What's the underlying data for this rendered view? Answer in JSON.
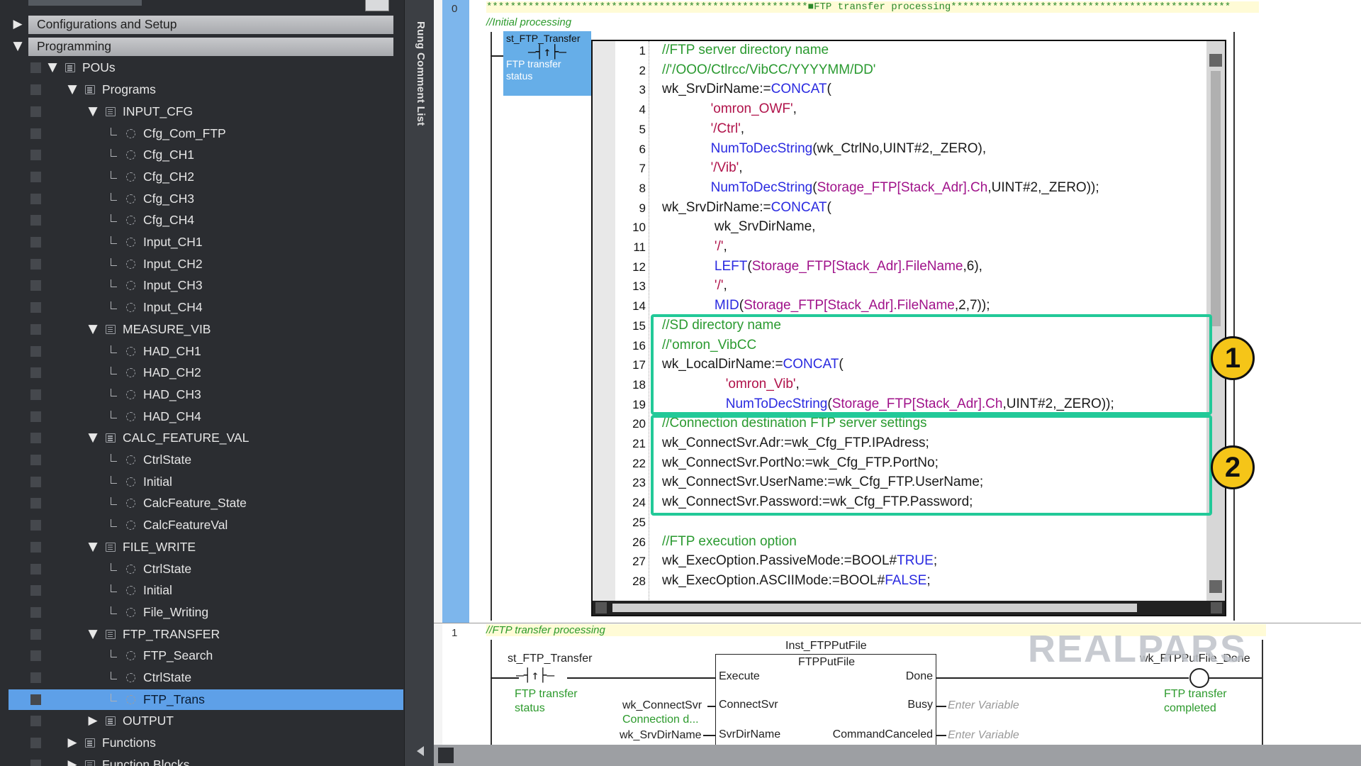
{
  "tree": {
    "items": [
      {
        "label": "Configurations and Setup",
        "toggle": "▶",
        "level": 0,
        "icon": "",
        "header": true
      },
      {
        "label": "Programming",
        "toggle": "▼",
        "level": 0,
        "icon": "",
        "header": true
      },
      {
        "label": "POUs",
        "toggle": "▼",
        "level": 1,
        "icon": "folder-icon"
      },
      {
        "label": "Programs",
        "toggle": "▼",
        "level": 2,
        "icon": "program-list-icon"
      },
      {
        "label": "INPUT_CFG",
        "toggle": "▼",
        "level": 3,
        "icon": "program-icon"
      },
      {
        "label": "Cfg_Com_FTP",
        "toggle": "",
        "level": 4,
        "icon": "section-icon"
      },
      {
        "label": "Cfg_CH1",
        "toggle": "",
        "level": 4,
        "icon": "section-icon"
      },
      {
        "label": "Cfg_CH2",
        "toggle": "",
        "level": 4,
        "icon": "section-icon"
      },
      {
        "label": "Cfg_CH3",
        "toggle": "",
        "level": 4,
        "icon": "section-icon"
      },
      {
        "label": "Cfg_CH4",
        "toggle": "",
        "level": 4,
        "icon": "section-icon"
      },
      {
        "label": "Input_CH1",
        "toggle": "",
        "level": 4,
        "icon": "section-icon"
      },
      {
        "label": "Input_CH2",
        "toggle": "",
        "level": 4,
        "icon": "section-icon"
      },
      {
        "label": "Input_CH3",
        "toggle": "",
        "level": 4,
        "icon": "section-icon"
      },
      {
        "label": "Input_CH4",
        "toggle": "",
        "level": 4,
        "icon": "section-icon"
      },
      {
        "label": "MEASURE_VIB",
        "toggle": "▼",
        "level": 3,
        "icon": "program-icon"
      },
      {
        "label": "HAD_CH1",
        "toggle": "",
        "level": 4,
        "icon": "section-icon"
      },
      {
        "label": "HAD_CH2",
        "toggle": "",
        "level": 4,
        "icon": "section-icon"
      },
      {
        "label": "HAD_CH3",
        "toggle": "",
        "level": 4,
        "icon": "section-icon"
      },
      {
        "label": "HAD_CH4",
        "toggle": "",
        "level": 4,
        "icon": "section-icon"
      },
      {
        "label": "CALC_FEATURE_VAL",
        "toggle": "▼",
        "level": 3,
        "icon": "program-icon"
      },
      {
        "label": "CtrlState",
        "toggle": "",
        "level": 4,
        "icon": "section-icon"
      },
      {
        "label": "Initial",
        "toggle": "",
        "level": 4,
        "icon": "section-icon"
      },
      {
        "label": "CalcFeature_State",
        "toggle": "",
        "level": 4,
        "icon": "section-icon"
      },
      {
        "label": "CalcFeatureVal",
        "toggle": "",
        "level": 4,
        "icon": "section-icon"
      },
      {
        "label": "FILE_WRITE",
        "toggle": "▼",
        "level": 3,
        "icon": "program-icon"
      },
      {
        "label": "CtrlState",
        "toggle": "",
        "level": 4,
        "icon": "section-icon"
      },
      {
        "label": "Initial",
        "toggle": "",
        "level": 4,
        "icon": "section-icon"
      },
      {
        "label": "File_Writing",
        "toggle": "",
        "level": 4,
        "icon": "section-icon"
      },
      {
        "label": "FTP_TRANSFER",
        "toggle": "▼",
        "level": 3,
        "icon": "program-icon"
      },
      {
        "label": "FTP_Search",
        "toggle": "",
        "level": 4,
        "icon": "section-icon"
      },
      {
        "label": "CtrlState",
        "toggle": "",
        "level": 4,
        "icon": "section-icon"
      },
      {
        "label": "FTP_Trans",
        "toggle": "",
        "level": 4,
        "icon": "section-icon",
        "selected": true
      },
      {
        "label": "OUTPUT",
        "toggle": "▶",
        "level": 3,
        "icon": "program-icon"
      },
      {
        "label": "Functions",
        "toggle": "▶",
        "level": 2,
        "icon": "program-list-icon"
      },
      {
        "label": "Function Blocks",
        "toggle": "▶",
        "level": 2,
        "icon": "program-list-icon"
      }
    ]
  },
  "sidebar_panel": {
    "label": "Rung Comment List"
  },
  "rung0": {
    "number": "0",
    "header": "******************************************************■FTP transfer processing***********************************************",
    "comment": "//Initial processing",
    "contact_name": "st_FTP_Transfer",
    "contact_symbol": "—┤↑├—",
    "contact_comment": "FTP transfer status"
  },
  "st_code": {
    "lines": [
      {
        "n": "1",
        "parts": [
          [
            "cm",
            "//FTP server directory name"
          ]
        ]
      },
      {
        "n": "2",
        "parts": [
          [
            "cm",
            "//'/OOO/Ctlrcc/VibCC/YYYYMM/DD'"
          ]
        ]
      },
      {
        "n": "3",
        "parts": [
          [
            "",
            "wk_SrvDirName:="
          ],
          [
            "kw",
            "CONCAT"
          ],
          [
            "",
            "("
          ]
        ]
      },
      {
        "n": "4",
        "parts": [
          [
            "",
            "             "
          ],
          [
            "st",
            "'omron_OWF'"
          ],
          [
            "",
            ","
          ]
        ]
      },
      {
        "n": "5",
        "parts": [
          [
            "",
            "             "
          ],
          [
            "st",
            "'/Ctrl'"
          ],
          [
            "",
            ","
          ]
        ]
      },
      {
        "n": "6",
        "parts": [
          [
            "",
            "             "
          ],
          [
            "kw",
            "NumToDecString"
          ],
          [
            "",
            "(wk_CtrlNo,UINT#2,_ZERO),"
          ]
        ]
      },
      {
        "n": "7",
        "parts": [
          [
            "",
            "             "
          ],
          [
            "st",
            "'/Vib'"
          ],
          [
            "",
            ","
          ]
        ]
      },
      {
        "n": "8",
        "parts": [
          [
            "",
            "             "
          ],
          [
            "kw",
            "NumToDecString"
          ],
          [
            "",
            "("
          ],
          [
            "pv",
            "Storage_FTP[Stack_Adr].Ch"
          ],
          [
            "",
            ",UINT#2,_ZERO));"
          ]
        ]
      },
      {
        "n": "9",
        "parts": [
          [
            "",
            "wk_SrvDirName:="
          ],
          [
            "kw",
            "CONCAT"
          ],
          [
            "",
            "("
          ]
        ]
      },
      {
        "n": "10",
        "parts": [
          [
            "",
            "              wk_SrvDirName,"
          ]
        ]
      },
      {
        "n": "11",
        "parts": [
          [
            "",
            "              "
          ],
          [
            "st",
            "'/'"
          ],
          [
            "",
            ","
          ]
        ]
      },
      {
        "n": "12",
        "parts": [
          [
            "",
            "              "
          ],
          [
            "kw",
            "LEFT"
          ],
          [
            "",
            "("
          ],
          [
            "pv",
            "Storage_FTP[Stack_Adr].FileName"
          ],
          [
            "",
            ",6),"
          ]
        ]
      },
      {
        "n": "13",
        "parts": [
          [
            "",
            "              "
          ],
          [
            "st",
            "'/'"
          ],
          [
            "",
            ","
          ]
        ]
      },
      {
        "n": "14",
        "parts": [
          [
            "",
            "              "
          ],
          [
            "kw",
            "MID"
          ],
          [
            "",
            "("
          ],
          [
            "pv",
            "Storage_FTP[Stack_Adr].FileName"
          ],
          [
            "",
            ",2,7));"
          ]
        ]
      },
      {
        "n": "15",
        "parts": [
          [
            "cm",
            "//SD directory name"
          ]
        ]
      },
      {
        "n": "16",
        "parts": [
          [
            "cm",
            "//'omron_VibCC"
          ]
        ]
      },
      {
        "n": "17",
        "parts": [
          [
            "",
            "wk_LocalDirName:="
          ],
          [
            "kw",
            "CONCAT"
          ],
          [
            "",
            "("
          ]
        ]
      },
      {
        "n": "18",
        "parts": [
          [
            "",
            "                 "
          ],
          [
            "st",
            "'omron_Vib'"
          ],
          [
            "",
            ","
          ]
        ]
      },
      {
        "n": "19",
        "parts": [
          [
            "",
            "                 "
          ],
          [
            "kw",
            "NumToDecString"
          ],
          [
            "",
            "("
          ],
          [
            "pv",
            "Storage_FTP[Stack_Adr].Ch"
          ],
          [
            "",
            ",UINT#2,_ZERO));"
          ]
        ]
      },
      {
        "n": "20",
        "parts": [
          [
            "cm",
            "//Connection destination FTP server settings"
          ]
        ]
      },
      {
        "n": "21",
        "parts": [
          [
            "",
            "wk_ConnectSvr.Adr:=wk_Cfg_FTP.IPAdress;"
          ]
        ]
      },
      {
        "n": "22",
        "parts": [
          [
            "",
            "wk_ConnectSvr.PortNo:=wk_Cfg_FTP.PortNo;"
          ]
        ]
      },
      {
        "n": "23",
        "parts": [
          [
            "",
            "wk_ConnectSvr.UserName:=wk_Cfg_FTP.UserName;"
          ]
        ]
      },
      {
        "n": "24",
        "parts": [
          [
            "",
            "wk_ConnectSvr.Password:=wk_Cfg_FTP.Password;"
          ]
        ]
      },
      {
        "n": "25",
        "parts": [
          [
            "",
            ""
          ]
        ]
      },
      {
        "n": "26",
        "parts": [
          [
            "cm",
            "//FTP execution option"
          ]
        ]
      },
      {
        "n": "27",
        "parts": [
          [
            "",
            "wk_ExecOption.PassiveMode:=BOOL#"
          ],
          [
            "kw",
            "TRUE"
          ],
          [
            "",
            ";"
          ]
        ]
      },
      {
        "n": "28",
        "parts": [
          [
            "",
            "wk_ExecOption.ASCIIMode:=BOOL#"
          ],
          [
            "kw",
            "FALSE"
          ],
          [
            "",
            ";"
          ]
        ]
      }
    ]
  },
  "badges": {
    "one": "1",
    "two": "2"
  },
  "rung1": {
    "number": "1",
    "comment": "//FTP transfer processing",
    "contact_name": "st_FTP_Transfer",
    "contact_symbol": "—┤↑├—",
    "contact_comment_1": "FTP transfer",
    "contact_comment_2": "status",
    "instance": "Inst_FTPPutFile",
    "fb_type": "FTPPutFile",
    "in_execute": "Execute",
    "in_connect": "ConnectSvr",
    "in_srvdir": "SvrDirName",
    "out_done": "Done",
    "out_busy": "Busy",
    "out_cmdcancel": "CommandCanceled",
    "var_connect": "wk_ConnectSvr",
    "var_connect_cmt": "Connection d...",
    "var_srvdir": "wk_SrvDirName",
    "enter_variable_1": "Enter Variable",
    "enter_variable_2": "Enter Variable",
    "coil_name": "wk_FTPPutFile_Done",
    "coil_comment_1": "FTP transfer",
    "coil_comment_2": "completed"
  },
  "watermark": "REALPARS"
}
